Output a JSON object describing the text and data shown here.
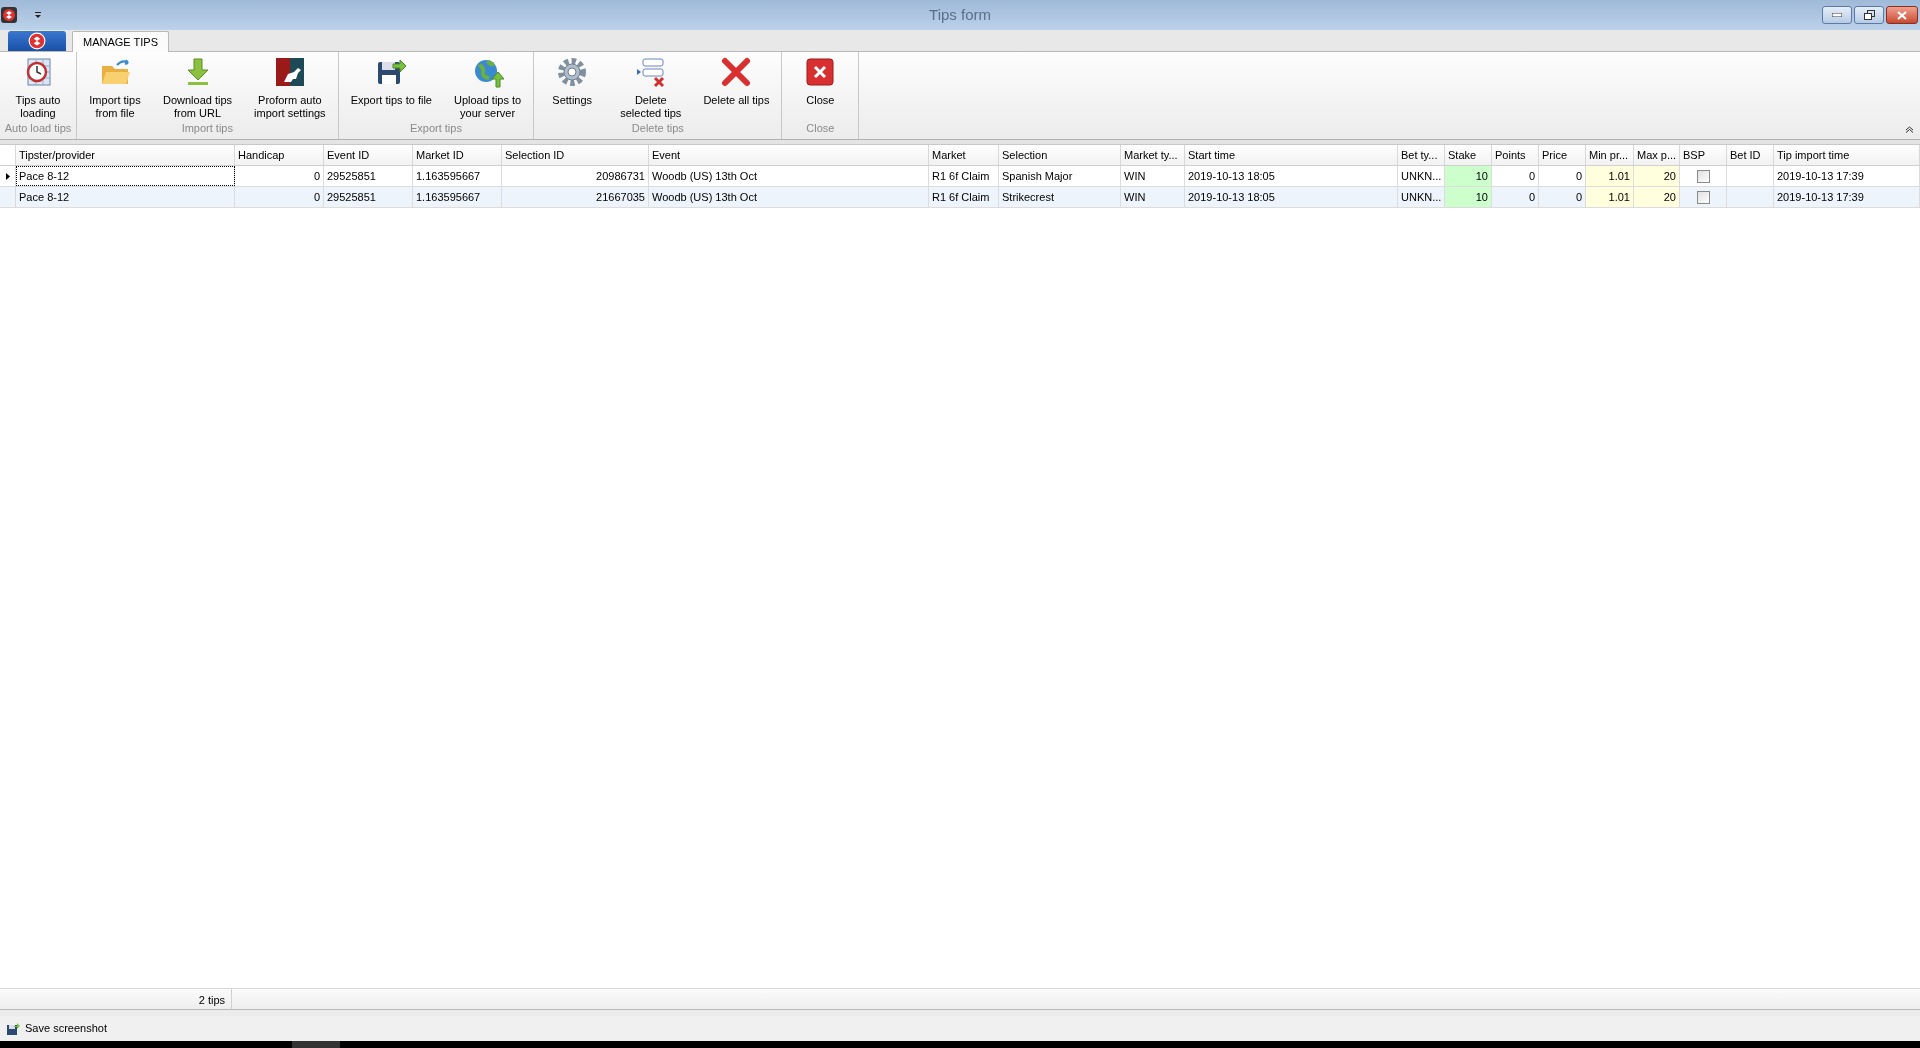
{
  "window": {
    "title": "Tips form"
  },
  "tabs": [
    {
      "label": "MANAGE TIPS",
      "selected": true
    }
  ],
  "ribbon": {
    "groups": [
      {
        "label": "Auto load tips",
        "buttons": [
          {
            "label": "Tips auto\nloading",
            "kind": "clock"
          }
        ]
      },
      {
        "label": "Import tips",
        "buttons": [
          {
            "label": "Import tips\nfrom file",
            "kind": "folder"
          },
          {
            "label": "Download tips\nfrom URL",
            "kind": "download"
          },
          {
            "label": "Proform auto\nimport settings",
            "kind": "proform"
          }
        ]
      },
      {
        "label": "Export tips",
        "buttons": [
          {
            "label": "Export tips to file",
            "kind": "save"
          },
          {
            "label": "Upload tips to\nyour server",
            "kind": "globe"
          }
        ]
      },
      {
        "label": "Delete tips",
        "buttons": [
          {
            "label": "Settings",
            "kind": "gear"
          },
          {
            "label": "Delete\nselected tips",
            "kind": "delete-selected"
          },
          {
            "label": "Delete all tips",
            "kind": "delete"
          }
        ]
      },
      {
        "label": "Close",
        "buttons": [
          {
            "label": "Close",
            "kind": "close"
          }
        ]
      }
    ]
  },
  "table": {
    "columns": [
      {
        "label": "Tipster/provider",
        "kind": "text"
      },
      {
        "label": "Handicap",
        "kind": "number"
      },
      {
        "label": "Event ID",
        "kind": "text"
      },
      {
        "label": "Market ID",
        "kind": "text"
      },
      {
        "label": "Selection ID",
        "kind": "number"
      },
      {
        "label": "Event",
        "kind": "text"
      },
      {
        "label": "Market",
        "kind": "text"
      },
      {
        "label": "Selection",
        "kind": "text"
      },
      {
        "label": "Market ty...",
        "kind": "text"
      },
      {
        "label": "Start time",
        "kind": "text"
      },
      {
        "label": "Bet ty...",
        "kind": "text"
      },
      {
        "label": "Stake",
        "kind": "number",
        "color": "#ccffcc"
      },
      {
        "label": "Points",
        "kind": "number"
      },
      {
        "label": "Price",
        "kind": "number"
      },
      {
        "label": "Min pr...",
        "kind": "number",
        "color": "#ffffdd"
      },
      {
        "label": "Max p...",
        "kind": "number",
        "color": "#ffffdd"
      },
      {
        "label": "BSP",
        "kind": "checkbox"
      },
      {
        "label": "Bet ID",
        "kind": "text"
      },
      {
        "label": "Tip import time",
        "kind": "text"
      }
    ],
    "rows": [
      {
        "current": true,
        "cells": [
          "Pace 8-12",
          "0",
          "29525851",
          "1.163595667",
          "20986731",
          "Woodb (US) 13th Oct",
          "R1 6f Claim",
          "Spanish Major",
          "WIN",
          "2019-10-13 18:05",
          "UNKN...",
          "10",
          "0",
          "0",
          "1.01",
          "20",
          false,
          "",
          "2019-10-13 17:39"
        ]
      },
      {
        "current": false,
        "cells": [
          "Pace 8-12",
          "0",
          "29525851",
          "1.163595667",
          "21667035",
          "Woodb (US) 13th Oct",
          "R1 6f Claim",
          "Strikecrest",
          "WIN",
          "2019-10-13 18:05",
          "UNKN...",
          "10",
          "0",
          "0",
          "1.01",
          "20",
          false,
          "",
          "2019-10-13 17:39"
        ]
      }
    ]
  },
  "footer": {
    "count": "2 tips"
  },
  "status_bar": {
    "button": "Save screenshot"
  }
}
